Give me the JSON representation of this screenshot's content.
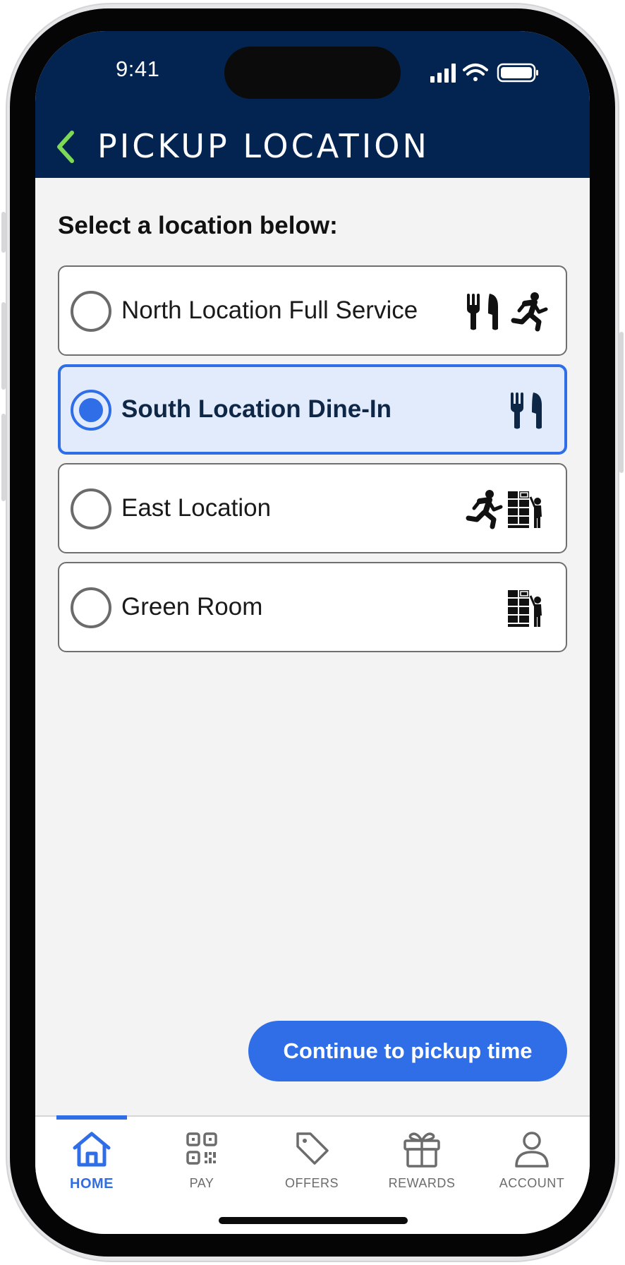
{
  "status_bar": {
    "time": "9:41"
  },
  "header": {
    "title": "PICKUP LOCATION"
  },
  "section_label": "Select a location below:",
  "locations": [
    {
      "name": "North Location Full Service",
      "selected": false,
      "icons": [
        "dine-in-icon",
        "running-person-icon"
      ]
    },
    {
      "name": "South Location Dine-In",
      "selected": true,
      "icons": [
        "dine-in-icon"
      ]
    },
    {
      "name": "East Location",
      "selected": false,
      "icons": [
        "running-person-icon",
        "pickup-locker-icon"
      ]
    },
    {
      "name": "Green Room",
      "selected": false,
      "icons": [
        "pickup-locker-icon"
      ]
    }
  ],
  "continue_label": "Continue to pickup time",
  "tabs": [
    {
      "label": "HOME",
      "icon": "home-icon",
      "active": true
    },
    {
      "label": "PAY",
      "icon": "qr-code-icon",
      "active": false
    },
    {
      "label": "OFFERS",
      "icon": "tag-icon",
      "active": false
    },
    {
      "label": "REWARDS",
      "icon": "gift-icon",
      "active": false
    },
    {
      "label": "ACCOUNT",
      "icon": "user-icon",
      "active": false
    }
  ],
  "colors": {
    "header_bg": "#032451",
    "accent": "#2f6ee6",
    "back_chevron": "#7ed957",
    "selected_bg": "#e2ebfb",
    "screen_bg": "#f3f3f3"
  }
}
